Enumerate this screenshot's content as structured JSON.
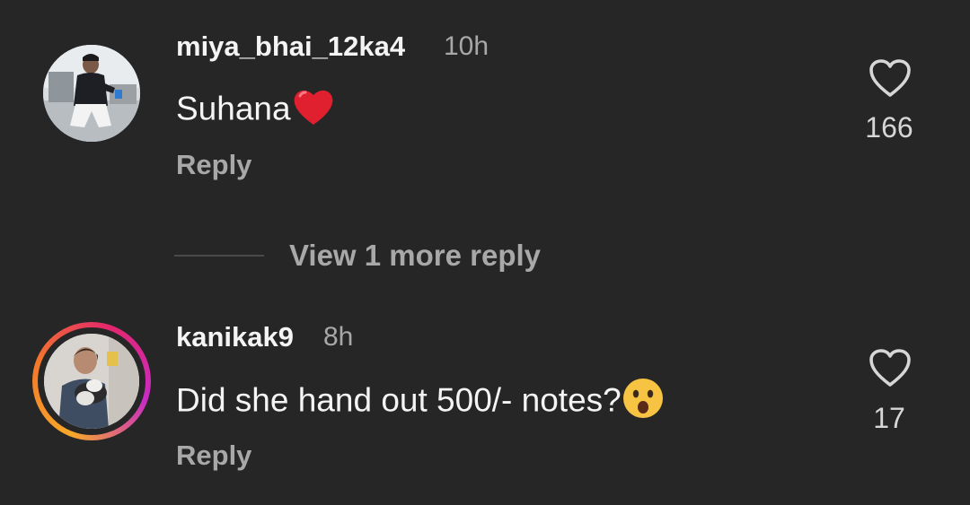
{
  "comments": [
    {
      "username": "miya_bhai_12ka4",
      "time": "10h",
      "text": "Suhana",
      "emoji": "red-heart",
      "reply_label": "Reply",
      "likes": "166",
      "has_story_ring": false
    },
    {
      "username": "kanikak9",
      "time": "8h",
      "text": "Did she hand out 500/- notes?",
      "emoji": "astonished-face",
      "reply_label": "Reply",
      "likes": "17",
      "has_story_ring": true
    }
  ],
  "view_more": {
    "label": "View 1 more reply"
  },
  "colors": {
    "background": "#262626",
    "primary_text": "#f4f4f4",
    "secondary_text": "#a8a8a8",
    "heart_emoji": "#e0202f",
    "story_ring": [
      "#f7a92a",
      "#e3266e",
      "#c82cc4"
    ]
  }
}
